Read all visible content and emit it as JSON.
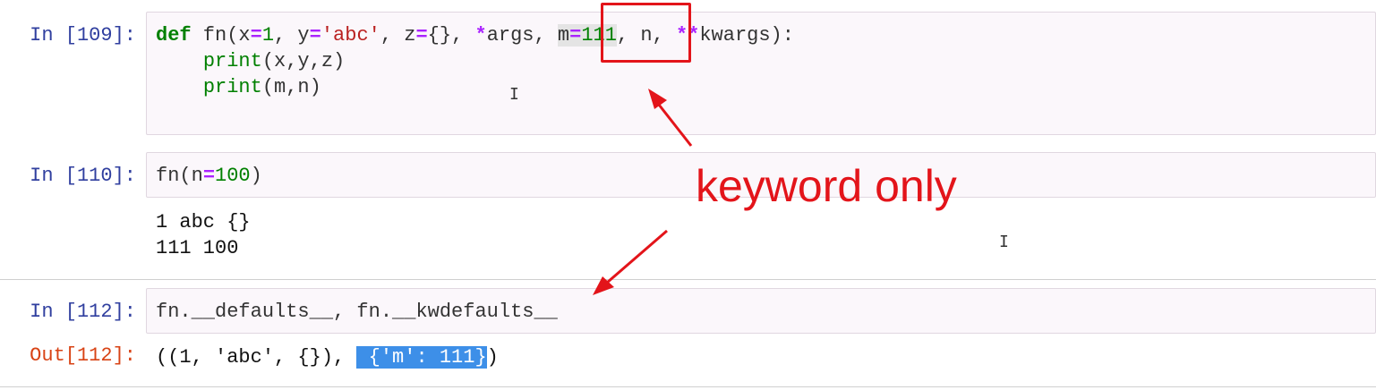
{
  "cells": [
    {
      "prompt": "In [109]:",
      "code_tokens": [
        [
          "def",
          "kw"
        ],
        [
          " fn(x",
          ""
        ],
        [
          "=",
          "op"
        ],
        [
          "1",
          "num"
        ],
        [
          ", y",
          ""
        ],
        [
          "=",
          "op"
        ],
        [
          "'abc'",
          "str"
        ],
        [
          ", z",
          ""
        ],
        [
          "=",
          "op"
        ],
        [
          "{}, ",
          ""
        ],
        [
          "*",
          "op"
        ],
        [
          "args, ",
          ""
        ],
        [
          "m",
          "mhl"
        ],
        [
          "=",
          "op mhl"
        ],
        [
          "111",
          "num mhl"
        ],
        [
          ", n, ",
          ""
        ],
        [
          "**",
          "op"
        ],
        [
          "kwargs):",
          ""
        ]
      ],
      "code_line2_tokens": [
        [
          "    ",
          ""
        ],
        [
          "print",
          "bi"
        ],
        [
          "(x,y,z)",
          ""
        ]
      ],
      "code_line3_tokens": [
        [
          "    ",
          ""
        ],
        [
          "print",
          "bi"
        ],
        [
          "(m,n)",
          ""
        ]
      ]
    },
    {
      "prompt": "In [110]:",
      "code_tokens": [
        [
          "fn(n",
          ""
        ],
        [
          "=",
          "op"
        ],
        [
          "100",
          "num"
        ],
        [
          ")",
          ""
        ]
      ],
      "output_lines": [
        "1 abc {}",
        "111 100"
      ]
    },
    {
      "prompt": "In [112]:",
      "code_tokens": [
        [
          "fn.__defaults__, fn.__kwdefaults__",
          ""
        ]
      ],
      "out_prompt": "Out[112]:",
      "output_tokens": [
        [
          "((1, 'abc', {}), ",
          ""
        ],
        [
          " {'m': 111}",
          "sel"
        ],
        [
          ")",
          ""
        ]
      ]
    }
  ],
  "annotation": {
    "text": "keyword only",
    "color": "#e3141a"
  }
}
